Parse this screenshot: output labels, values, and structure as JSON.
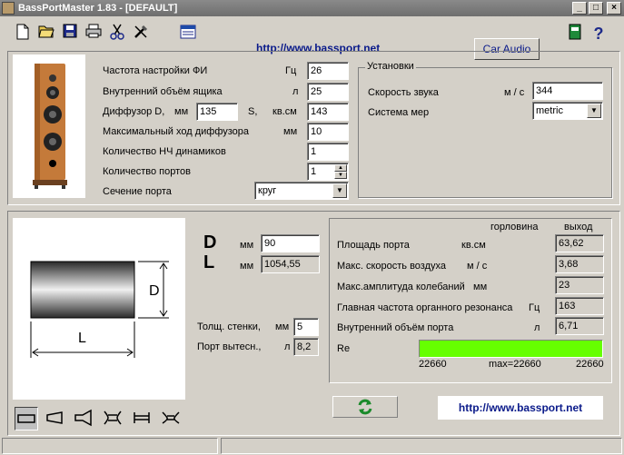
{
  "window": {
    "title": "BassPortMaster 1.83  - [DEFAULT]"
  },
  "toolbar": {
    "url": "http://www.bassport.net",
    "car_audio_label": "Car Audio"
  },
  "params": {
    "tuning_freq": {
      "label": "Частота настройки ФИ",
      "unit": "Гц",
      "value": "26"
    },
    "box_volume": {
      "label": "Внутренний объём ящика",
      "unit": "л",
      "value": "25"
    },
    "diffuser": {
      "label": "Диффузор D,",
      "unit_mm": "мм",
      "d_value": "135",
      "s_label": "S,",
      "unit_cm": "кв.см",
      "s_value": "143"
    },
    "max_excursion": {
      "label": "Максимальный ход диффузора",
      "unit": "мм",
      "value": "10"
    },
    "woofer_count": {
      "label": "Количество НЧ динамиков",
      "value": "1"
    },
    "port_count": {
      "label": "Количество портов",
      "value": "1"
    },
    "port_section": {
      "label": "Сечение порта",
      "value": "круг"
    }
  },
  "settings": {
    "title": "Установки",
    "sound_speed": {
      "label": "Скорость звука",
      "unit": "м / с",
      "value": "344"
    },
    "measure_system": {
      "label": "Система мер",
      "value": "metric"
    }
  },
  "port": {
    "d_big": "D",
    "l_big": "L",
    "d_unit": "мм",
    "d_value": "90",
    "l_unit": "мм",
    "l_value": "1054,55",
    "diagram_d": "D",
    "diagram_l": "L",
    "wall": {
      "label": "Толщ. стенки,",
      "unit": "мм",
      "value": "5"
    },
    "displacement": {
      "label": "Порт вытесн.,",
      "unit": "л",
      "value": "8,2"
    }
  },
  "results": {
    "col_throat": "горловина",
    "col_outlet": "выход",
    "rows": [
      {
        "label": "Площадь порта",
        "unit": "кв.см",
        "value": "63,62"
      },
      {
        "label": "Макс. скорость воздуха",
        "unit": "м / с",
        "value": "3,68"
      },
      {
        "label": "Макс.амплитуда колебаний",
        "unit": "мм",
        "value": "23"
      },
      {
        "label": "Главная частота органного резонанса",
        "unit": "Гц",
        "value": "163"
      },
      {
        "label": "Внутренний объём порта",
        "unit": "л",
        "value": "6,71"
      }
    ],
    "re_label": "Re",
    "re_min": "22660",
    "re_mid": "max=22660",
    "re_max": "22660",
    "re_fill": 1.0,
    "re_color": "#66ff00"
  },
  "bottom": {
    "url": "http://www.bassport.net"
  }
}
